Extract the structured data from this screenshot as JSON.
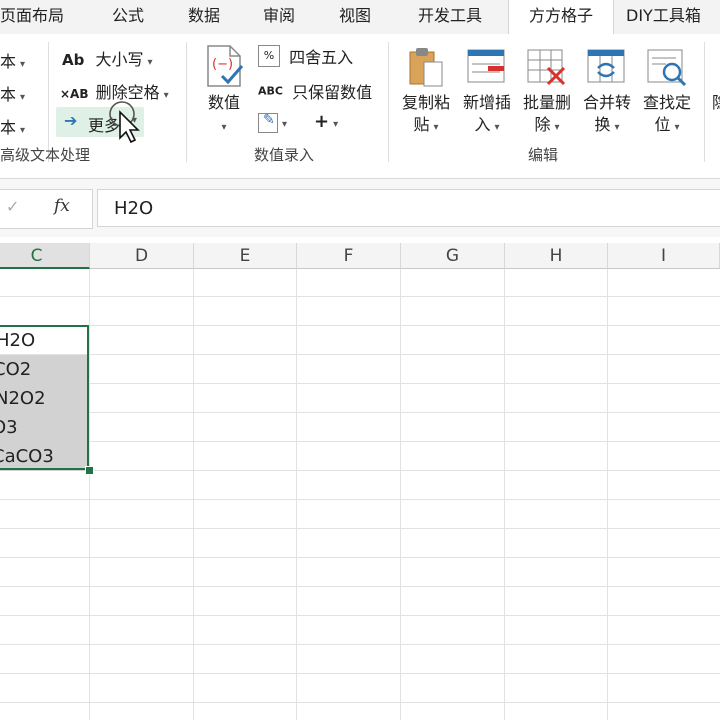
{
  "tabs": [
    {
      "label": "页面布局",
      "active": false
    },
    {
      "label": "公式",
      "active": false
    },
    {
      "label": "数据",
      "active": false
    },
    {
      "label": "审阅",
      "active": false
    },
    {
      "label": "视图",
      "active": false
    },
    {
      "label": "开发工具",
      "active": false
    },
    {
      "label": "方方格子",
      "active": true
    },
    {
      "label": "DIY工具箱",
      "active": false
    }
  ],
  "ribbon": {
    "left_col": [
      "本",
      "本",
      "本"
    ],
    "text_group": {
      "case_label": "大小写",
      "case_icon": "Ab",
      "remove_space_label": "删除空格",
      "remove_space_icon": "×AB",
      "more_label": "更多",
      "group_label": "高级文本处理"
    },
    "number_group": {
      "value_label": "数值",
      "round_label": "四舍五入",
      "round_icon": "%",
      "keep_value_label": "只保留数值",
      "keep_value_icon": "ABC",
      "plus_symbol": "+",
      "group_label": "数值录入"
    },
    "edit_group": {
      "copy_paste": [
        "复制粘",
        "贴"
      ],
      "new_insert": [
        "新增插",
        "入"
      ],
      "batch_delete": [
        "批量删",
        "除"
      ],
      "merge_convert": [
        "合并转",
        "换"
      ],
      "find_locate": [
        "查找定",
        "位"
      ],
      "partial_next": "隐",
      "group_label": "编辑"
    }
  },
  "formula_bar": {
    "cancel_symbol": "✓",
    "fx_symbol": "fx",
    "value": "H2O"
  },
  "columns": [
    "C",
    "D",
    "E",
    "F",
    "G",
    "H",
    "I"
  ],
  "cells": [
    "H2O",
    "CO2",
    "N2O2",
    "O3",
    "CaCO3"
  ],
  "colors": {
    "accent": "#217346",
    "selection_fill": "#d2d2d2",
    "red": "#d9302c",
    "blue": "#2e75b6"
  }
}
